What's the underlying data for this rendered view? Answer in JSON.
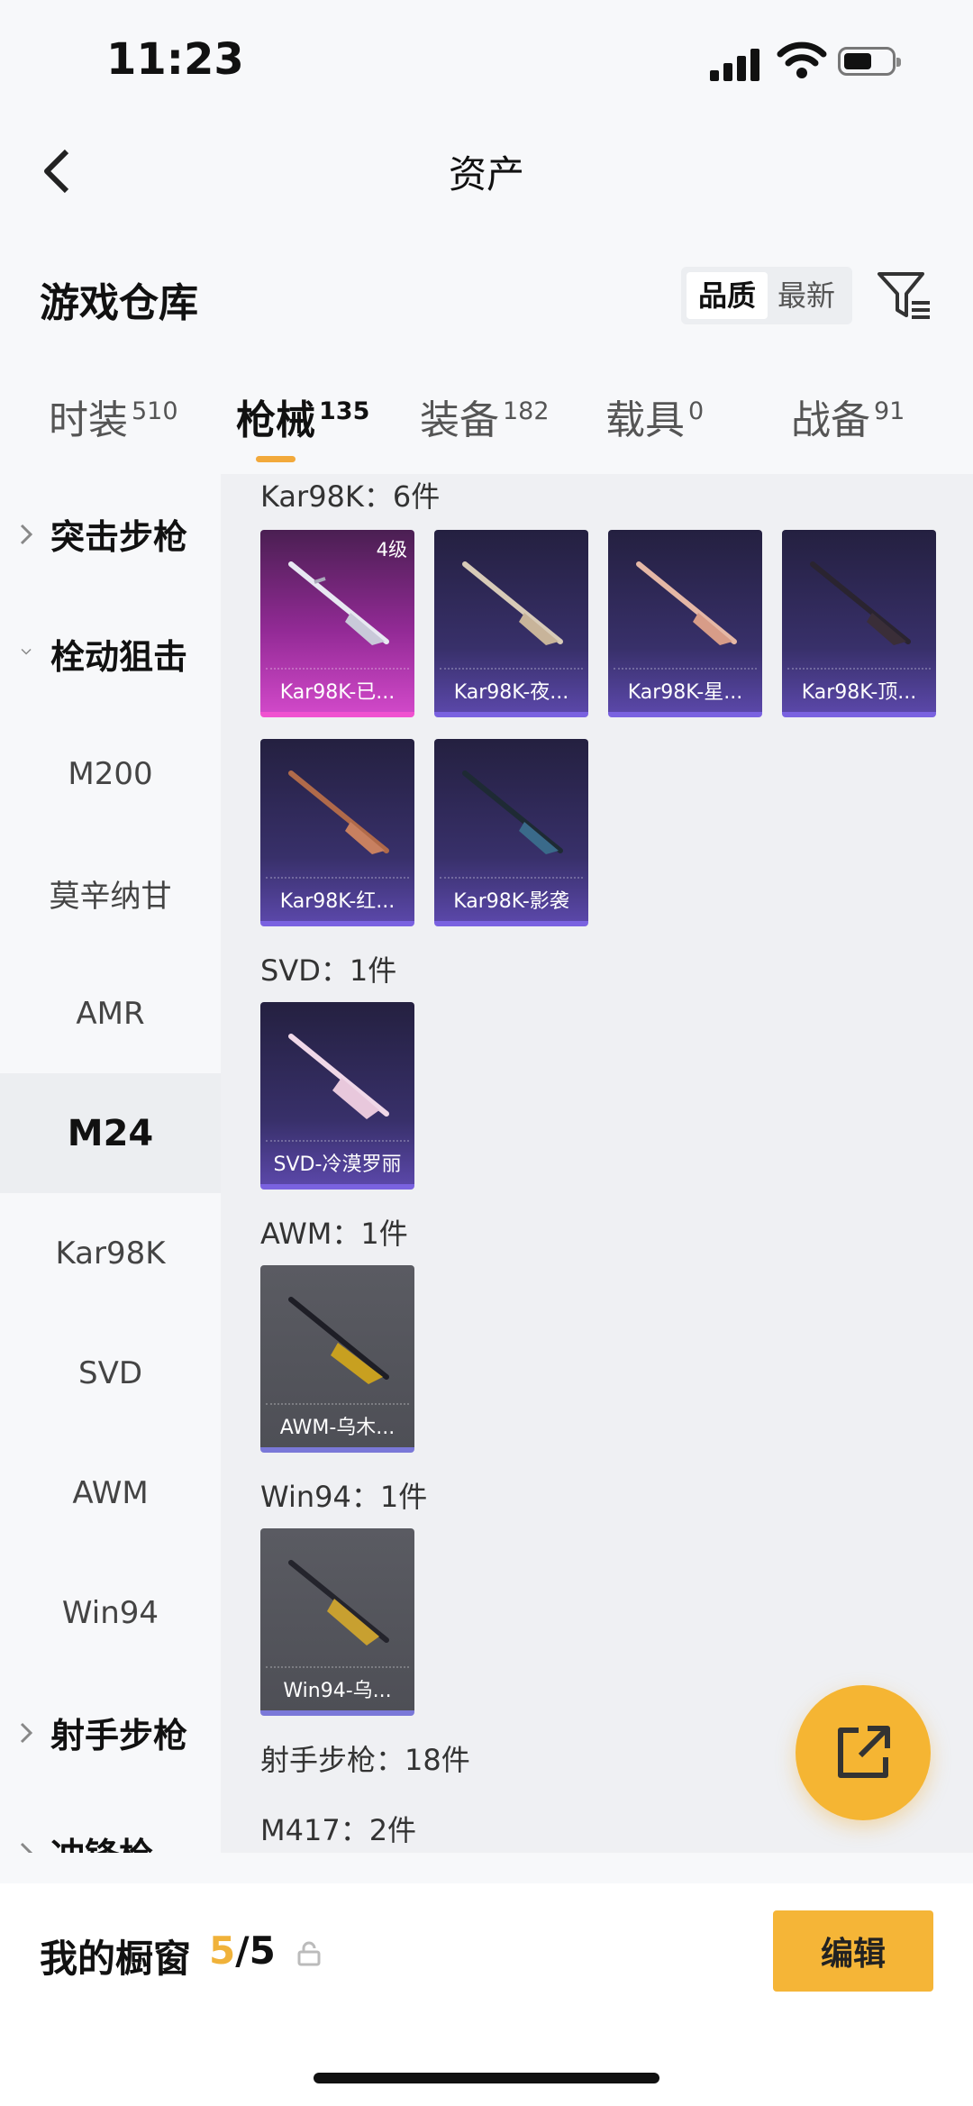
{
  "status_bar": {
    "time": "11:23"
  },
  "header": {
    "title": "资产"
  },
  "warehouse": {
    "title": "游戏仓库",
    "sort_options": [
      "品质",
      "最新"
    ]
  },
  "tabs": [
    {
      "label": "时装",
      "count": "510"
    },
    {
      "label": "枪械",
      "count": "135"
    },
    {
      "label": "装备",
      "count": "182"
    },
    {
      "label": "载具",
      "count": "0"
    },
    {
      "label": "战备",
      "count": "91"
    }
  ],
  "sidebar": {
    "items": [
      {
        "label": "突击步枪"
      },
      {
        "label": "栓动狙击"
      },
      {
        "label": "M200"
      },
      {
        "label": "莫辛纳甘"
      },
      {
        "label": "AMR"
      },
      {
        "label": "M24"
      },
      {
        "label": "Kar98K"
      },
      {
        "label": "SVD"
      },
      {
        "label": "AWM"
      },
      {
        "label": "Win94"
      },
      {
        "label": "射手步枪"
      },
      {
        "label": "冲锋枪"
      }
    ]
  },
  "groups": {
    "kar98k": {
      "label": "Kar98K：6件",
      "items": [
        {
          "name": "Kar98K-已...",
          "tier": "4级"
        },
        {
          "name": "Kar98K-夜..."
        },
        {
          "name": "Kar98K-星..."
        },
        {
          "name": "Kar98K-顶..."
        },
        {
          "name": "Kar98K-红..."
        },
        {
          "name": "Kar98K-影袭"
        }
      ]
    },
    "svd": {
      "label": "SVD：1件",
      "items": [
        {
          "name": "SVD-冷漠罗丽"
        }
      ]
    },
    "awm": {
      "label": "AWM：1件",
      "items": [
        {
          "name": "AWM-乌木..."
        }
      ]
    },
    "win94": {
      "label": "Win94：1件",
      "items": [
        {
          "name": "Win94-乌..."
        }
      ]
    },
    "marksman": {
      "label": "射手步枪：18件"
    },
    "m417": {
      "label": "M417：2件"
    }
  },
  "showcase": {
    "label": "我的橱窗",
    "current": "5",
    "total": "/5",
    "edit_label": "编辑"
  },
  "colors": {
    "accent": "#f5b537",
    "purple_rarity": "#7a62e0",
    "pink_rarity": "#f052d0"
  },
  "icons": {
    "back": "chevron-left-icon",
    "filter": "filter-icon",
    "share": "share-icon",
    "lock": "lock-icon"
  }
}
